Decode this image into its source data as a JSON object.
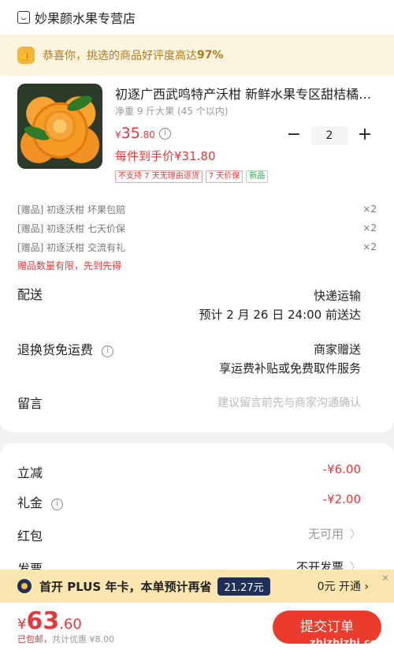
{
  "store": {
    "name": "妙果颜水果专营店"
  },
  "praise": {
    "text": "恭喜你，挑选的商品好评度高达",
    "percent": "97%"
  },
  "product": {
    "title": "初逐广西武鸣特产沃柑 新鲜水果专区甜桔橘…",
    "spec": "净重 9 斤大果 (45 个以内)",
    "price_currency": "¥",
    "price_int": "35",
    "price_dec": ".80",
    "unit_price": "每件到手价¥31.80",
    "tags": [
      {
        "text": "不支持 7 天无理由退货"
      },
      {
        "text": "7 天价保"
      },
      {
        "text": "新品"
      }
    ],
    "quantity": "2",
    "minus": "−",
    "plus": "+"
  },
  "gifts": [
    {
      "text": "[赠品]  初逐沃柑  坏果包赔",
      "qty": "×2"
    },
    {
      "text": "[赠品]  初逐沃柑  七天价保",
      "qty": "×2"
    },
    {
      "text": "[赠品]  初逐沃柑  交流有礼",
      "qty": "×2"
    }
  ],
  "gift_note": "赠品数量有限，先到先得",
  "delivery": {
    "label": "配送",
    "method": "快递运输",
    "eta": "预计 2 月 26 日 24:00 前送达"
  },
  "return_shipping": {
    "label": "退换货免运费",
    "giver": "商家赠送",
    "desc": "享运费补贴或免费取件服务"
  },
  "message": {
    "label": "留言",
    "placeholder": "建议留言前先与商家沟通确认"
  },
  "discounts": {
    "instant": {
      "label": "立减",
      "value": "-¥6.00"
    },
    "gift_money": {
      "label": "礼金",
      "value": "-¥2.00"
    },
    "red_packet": {
      "label": "红包",
      "value": "无可用"
    },
    "invoice": {
      "label": "发票",
      "value": "不开发票"
    }
  },
  "plus_banner": {
    "text": "首开 PLUS 年卡，本单预计再省",
    "amount": "21.27元",
    "cta": "0元 开通 ›",
    "close": "✕"
  },
  "total": {
    "currency": "¥",
    "int": "63",
    "dec": ".60",
    "shipping": "已包邮，",
    "saved": "共计优惠 ¥8.00"
  },
  "submit": {
    "label": "提交订单"
  },
  "watermark": "zhizhizhi.com"
}
